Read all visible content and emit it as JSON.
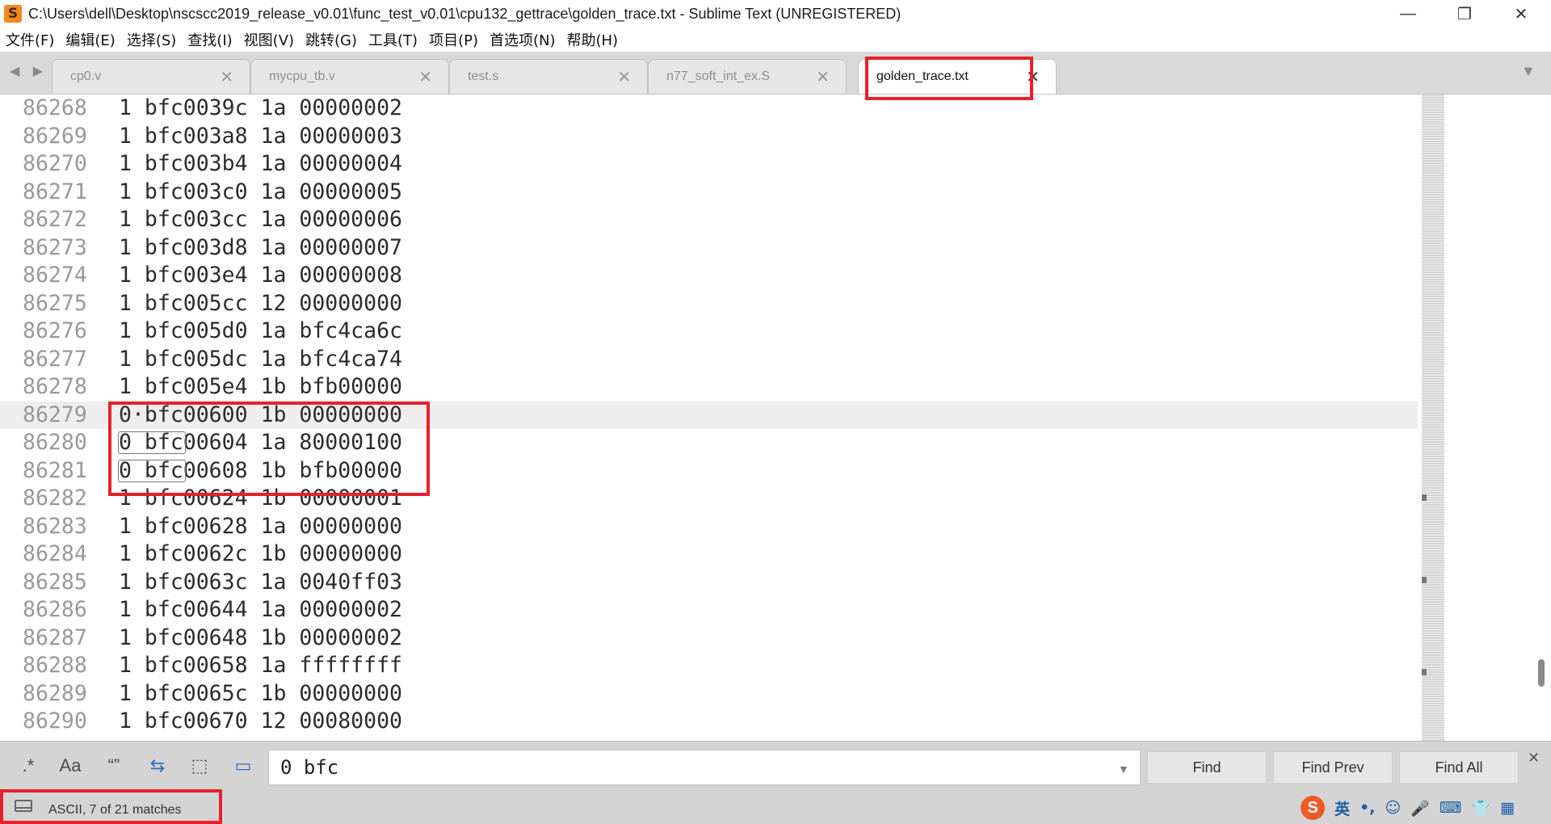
{
  "window": {
    "title": "C:\\Users\\dell\\Desktop\\nscscc2019_release_v0.01\\func_test_v0.01\\cpu132_gettrace\\golden_trace.txt - Sublime Text (UNREGISTERED)",
    "app_icon_glyph": "S",
    "min_glyph": "—",
    "max_glyph": "❐",
    "close_glyph": "✕"
  },
  "menu": [
    "文件(F)",
    "编辑(E)",
    "选择(S)",
    "查找(I)",
    "视图(V)",
    "跳转(G)",
    "工具(T)",
    "项目(P)",
    "首选项(N)",
    "帮助(H)"
  ],
  "tabs": {
    "nav_glyph": "◀ ▶",
    "overflow_glyph": "▼",
    "close_glyph": "✕",
    "items": [
      {
        "label": "cp0.v",
        "active": false
      },
      {
        "label": "mycpu_tb.v",
        "active": false
      },
      {
        "label": "test.s",
        "active": false
      },
      {
        "label": "n77_soft_int_ex.S",
        "active": false
      },
      {
        "label": "golden_trace.txt",
        "active": true
      }
    ]
  },
  "editor": {
    "current_line": "86279",
    "lines": [
      {
        "no": "86268",
        "text": "1 bfc0039c 1a 00000002"
      },
      {
        "no": "86269",
        "text": "1 bfc003a8 1a 00000003"
      },
      {
        "no": "86270",
        "text": "1 bfc003b4 1a 00000004"
      },
      {
        "no": "86271",
        "text": "1 bfc003c0 1a 00000005"
      },
      {
        "no": "86272",
        "text": "1 bfc003cc 1a 00000006"
      },
      {
        "no": "86273",
        "text": "1 bfc003d8 1a 00000007"
      },
      {
        "no": "86274",
        "text": "1 bfc003e4 1a 00000008"
      },
      {
        "no": "86275",
        "text": "1 bfc005cc 12 00000000"
      },
      {
        "no": "86276",
        "text": "1 bfc005d0 1a bfc4ca6c"
      },
      {
        "no": "86277",
        "text": "1 bfc005dc 1a bfc4ca74"
      },
      {
        "no": "86278",
        "text": "1 bfc005e4 1b bfb00000"
      },
      {
        "no": "86279",
        "text": "0·bfc00600 1b 00000000"
      },
      {
        "no": "86280",
        "text": "0 bfc00604 1a 80000100"
      },
      {
        "no": "86281",
        "text": "0 bfc00608 1b bfb00000"
      },
      {
        "no": "86282",
        "text": "1 bfc00624 1b 00000001"
      },
      {
        "no": "86283",
        "text": "1 bfc00628 1a 00000000"
      },
      {
        "no": "86284",
        "text": "1 bfc0062c 1b 00000000"
      },
      {
        "no": "86285",
        "text": "1 bfc0063c 1a 0040ff03"
      },
      {
        "no": "86286",
        "text": "1 bfc00644 1a 00000002"
      },
      {
        "no": "86287",
        "text": "1 bfc00648 1b 00000002"
      },
      {
        "no": "86288",
        "text": "1 bfc00658 1a ffffffff"
      },
      {
        "no": "86289",
        "text": "1 bfc0065c 1b 00000000"
      },
      {
        "no": "86290",
        "text": "1 bfc00670 12 00080000"
      }
    ],
    "match_lines": [
      "86280",
      "86281"
    ]
  },
  "find": {
    "regex_glyph": ".*",
    "case_glyph": "Aa",
    "word_glyph": "“”",
    "wrap_glyph": "⇆",
    "selection_glyph": "⬚",
    "highlight_glyph": "▭",
    "query": "0 bfc",
    "history_glyph": "▼",
    "find_label": "Find",
    "find_prev_label": "Find Prev",
    "find_all_label": "Find All",
    "close_glyph": "✕"
  },
  "status": {
    "text": "ASCII, 7 of 21 matches",
    "tray": {
      "ime_logo": "S",
      "ime_mode": "英",
      "items": [
        "•,",
        "☺",
        "🎤",
        "⌨",
        "👕",
        "▦"
      ]
    }
  }
}
